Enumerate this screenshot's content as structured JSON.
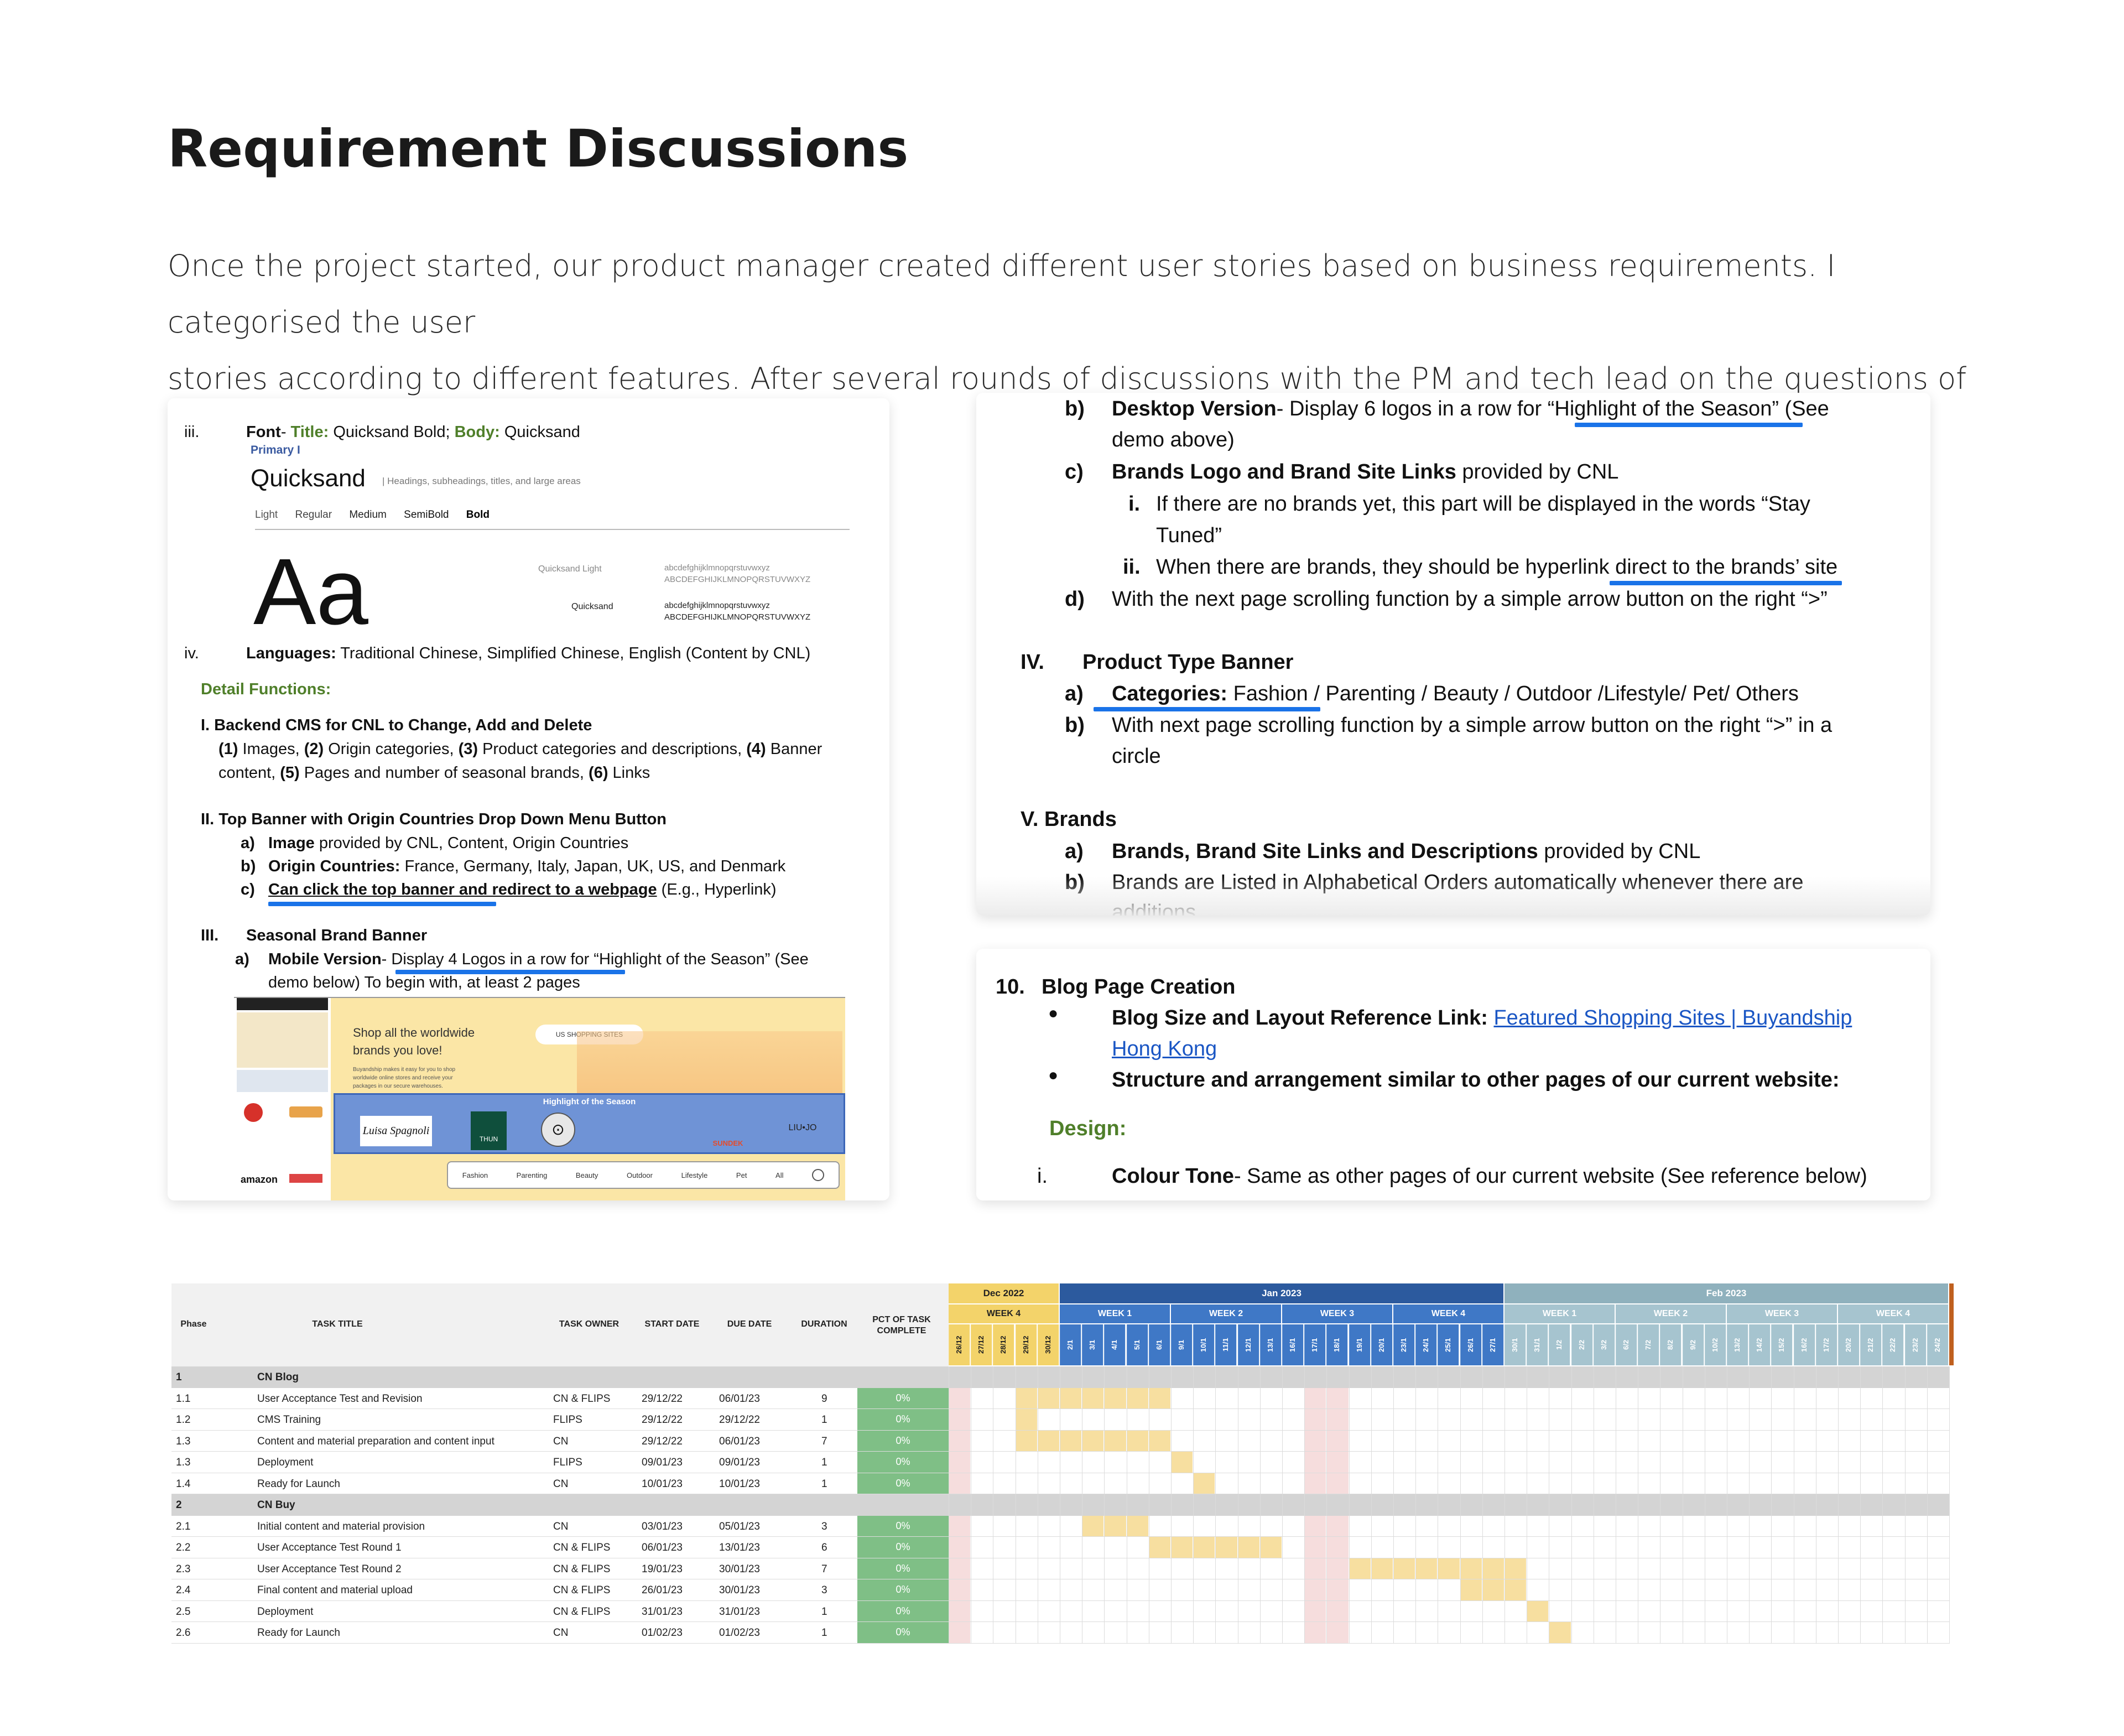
{
  "page": {
    "heading": "Requirement Discussions",
    "intro_line1": "Once the project started, our product manager created different user stories based on business requirements. I categorised the user",
    "intro_line2": "stories according to different features. After several rounds of discussions with the PM and tech lead on the questions of the features."
  },
  "card1": {
    "iii": "iii.",
    "font_label": "Font",
    "font_title_label": "Title:",
    "font_title_value": "Quicksand Bold;",
    "font_body_label": "Body:",
    "font_body_value": "Quicksand",
    "primary_label": "Primary I",
    "quicksand_name": "Quicksand",
    "quicksand_desc": "| Headings, subheadings, titles, and large areas",
    "weights": [
      "Light",
      "Regular",
      "Medium",
      "SemiBold",
      "Bold"
    ],
    "big_aa": "Aa",
    "sample_light_label": "Quicksand Light",
    "sample_regular_label": "Quicksand",
    "sample_lower": "abcdefghijklmnopqrstuvwxyz",
    "sample_upper": "ABCDEFGHIJKLMNOPQRSTUVWXYZ",
    "iv": "iv.",
    "languages_label": "Languages:",
    "languages_value": "Traditional Chinese, Simplified Chinese, English (Content by CNL)",
    "detail_functions": "Detail Functions:",
    "s1_title": "I.  Backend CMS for CNL to Change, Add and Delete",
    "s1_line1_parts": [
      "(1)",
      " Images, ",
      "(2)",
      " Origin categories, ",
      "(3)",
      " Product categories and descriptions, ",
      "(4)",
      " Banner"
    ],
    "s1_line2_parts": [
      "content, ",
      "(5)",
      " Pages and number of seasonal brands, ",
      "(6)",
      " Links"
    ],
    "s2_title": "II. Top Banner with Origin Countries Drop Down Menu Button",
    "s2_a_marker": "a)",
    "s2_a_bold": "Image",
    "s2_a_rest": " provided by CNL, Content, Origin Countries",
    "s2_b_marker": "b)",
    "s2_b_bold": "Origin Countries:",
    "s2_b_rest": " France, Germany, Italy, Japan, UK, US, and Denmark",
    "s2_c_marker": "c)",
    "s2_c_bold": "Can click the top banner and redirect to a webpage",
    "s2_c_rest": " (E.g., Hyperlink)",
    "s3_marker": "III.",
    "s3_title": "Seasonal Brand Banner",
    "s3_a_marker": "a)",
    "s3_a_bold": "Mobile Version",
    "s3_a_rest": "- Display 4 Logos in a row for “Highlight of the Season” (See",
    "s3_a_line2": "demo below) To begin with, at least 2 pages",
    "screenshot": {
      "hero_line1": "Shop all the worldwide",
      "hero_line2": "brands you love!",
      "hero_small": "Buyandship makes it easy for you to shop worldwide online stores and receive your packages in our secure warehouses.",
      "us_button": "US SHOPPING SITES",
      "highlight": "Highlight of the Season",
      "logos": [
        "Luisa Spagnoli",
        "THUN",
        "⊙",
        "SUNDEK",
        "LIU•JO"
      ],
      "categories": [
        "Fashion",
        "Parenting",
        "Beauty",
        "Outdoor",
        "Lifestyle",
        "Pet",
        "All"
      ],
      "amazon": "amazon"
    }
  },
  "card2": {
    "b_marker": "b)",
    "b_bold": "Desktop Version",
    "b_rest": "- Display 6 logos in a row for “Highlight of the Season” (See",
    "b_line2": "demo above)",
    "c_marker": "c)",
    "c_bold": "Brands Logo and Brand Site Links",
    "c_rest": " provided by CNL",
    "ci_marker": "i.",
    "ci_text": "If there are no brands yet, this part will be displayed in the words “Stay",
    "ci_line2": "Tuned”",
    "cii_marker": "ii.",
    "cii_text": "When there are brands, they should be hyperlink direct to the brands’ site",
    "d_marker": "d)",
    "d_text": "With the next page scrolling function by a simple arrow button on the right “>”",
    "iv_marker": "IV.",
    "iv_title": "Product Type Banner",
    "iva_marker": "a)",
    "iva_bold": "Categories:",
    "iva_rest": " Fashion / Parenting / Beauty / Outdoor /Lifestyle/ Pet/ Others",
    "ivb_marker": "b)",
    "ivb_text": "With next page scrolling function by a simple arrow button on the right “>” in a",
    "ivb_line2": "circle",
    "v_title": "V. Brands",
    "va_marker": "a)",
    "va_bold": "Brands, Brand Site Links and Descriptions",
    "va_rest": " provided by CNL",
    "vb_marker": "b)",
    "vb_text": "Brands are Listed in Alphabetical Orders automatically whenever there are",
    "vb_line2": "additions"
  },
  "card3": {
    "num": "10.",
    "title": "Blog Page Creation",
    "bullet1_bold": "Blog Size and Layout Reference Link:",
    "bullet1_link_line1": "Featured Shopping Sites | Buyandship",
    "bullet1_link_line2": "Hong Kong",
    "bullet2_bold": "Structure and arrangement similar to other pages of our current website:",
    "design": "Design:",
    "i_marker": "i.",
    "i_bold": "Colour Tone",
    "i_rest": "- Same as other pages of our current website (See reference below)"
  },
  "gantt": {
    "headers": {
      "phase": "Phase",
      "task_title": "TASK TITLE",
      "task_owner": "TASK OWNER",
      "start": "START DATE",
      "due": "DUE DATE",
      "duration": "DURATION",
      "pct_line1": "PCT OF TASK",
      "pct_line2": "COMPLETE"
    },
    "months": [
      {
        "label": "Dec 2022",
        "color": "#f3d36a",
        "text": "#222222"
      },
      {
        "label": "Jan 2023",
        "color": "#2c5a9e",
        "text": "#ffffff"
      },
      {
        "label": "Feb 2023",
        "color": "#8fb1bd",
        "text": "#ffffff"
      }
    ],
    "weeks": [
      "WEEK 4",
      "WEEK 1",
      "WEEK 2",
      "WEEK 3",
      "WEEK 4",
      "WEEK 1",
      "WEEK 2",
      "WEEK 3",
      "WEEK 4"
    ],
    "days": [
      "26/12",
      "27/12",
      "28/12",
      "29/12",
      "30/12",
      "2/1",
      "3/1",
      "4/1",
      "5/1",
      "6/1",
      "9/1",
      "10/1",
      "11/1",
      "12/1",
      "13/1",
      "16/1",
      "17/1",
      "18/1",
      "19/1",
      "20/1",
      "23/1",
      "24/1",
      "25/1",
      "26/1",
      "27/1",
      "30/1",
      "31/1",
      "1/2",
      "2/2",
      "3/2",
      "6/2",
      "7/2",
      "8/2",
      "9/2",
      "10/2",
      "13/2",
      "14/2",
      "15/2",
      "16/2",
      "17/2",
      "20/2",
      "21/2",
      "22/2",
      "23/2",
      "24/2"
    ],
    "phases": [
      {
        "id": "1",
        "name": "CN Blog",
        "rows": [
          {
            "id": "1.1",
            "title": "User Acceptance Test and Revision",
            "owner": "CN & FLIPS",
            "start": "29/12/22",
            "due": "06/01/23",
            "duration": "9",
            "pct": "0%"
          },
          {
            "id": "1.2",
            "title": "CMS Training",
            "owner": "FLIPS",
            "start": "29/12/22",
            "due": "29/12/22",
            "duration": "1",
            "pct": "0%"
          },
          {
            "id": "1.3",
            "title": "Content and material preparation and content input",
            "owner": "CN",
            "start": "29/12/22",
            "due": "06/01/23",
            "duration": "7",
            "pct": "0%"
          },
          {
            "id": "1.3",
            "title": "Deployment",
            "owner": "FLIPS",
            "start": "09/01/23",
            "due": "09/01/23",
            "duration": "1",
            "pct": "0%"
          },
          {
            "id": "1.4",
            "title": "Ready for Launch",
            "owner": "CN",
            "start": "10/01/23",
            "due": "10/01/23",
            "duration": "1",
            "pct": "0%"
          }
        ]
      },
      {
        "id": "2",
        "name": "CN Buy",
        "rows": [
          {
            "id": "2.1",
            "title": "Initial content and material provision",
            "owner": "CN",
            "start": "03/01/23",
            "due": "05/01/23",
            "duration": "3",
            "pct": "0%"
          },
          {
            "id": "2.2",
            "title": "User Acceptance Test Round 1",
            "owner": "CN & FLIPS",
            "start": "06/01/23",
            "due": "13/01/23",
            "duration": "6",
            "pct": "0%"
          },
          {
            "id": "2.3",
            "title": "User Acceptance Test Round 2",
            "owner": "CN & FLIPS",
            "start": "19/01/23",
            "due": "30/01/23",
            "duration": "7",
            "pct": "0%"
          },
          {
            "id": "2.4",
            "title": "Final content and material upload",
            "owner": "CN & FLIPS",
            "start": "26/01/23",
            "due": "30/01/23",
            "duration": "3",
            "pct": "0%"
          },
          {
            "id": "2.5",
            "title": "Deployment",
            "owner": "CN & FLIPS",
            "start": "31/01/23",
            "due": "31/01/23",
            "duration": "1",
            "pct": "0%"
          },
          {
            "id": "2.6",
            "title": "Ready for Launch",
            "owner": "CN",
            "start": "01/02/23",
            "due": "01/02/23",
            "duration": "1",
            "pct": "0%"
          }
        ]
      }
    ]
  }
}
